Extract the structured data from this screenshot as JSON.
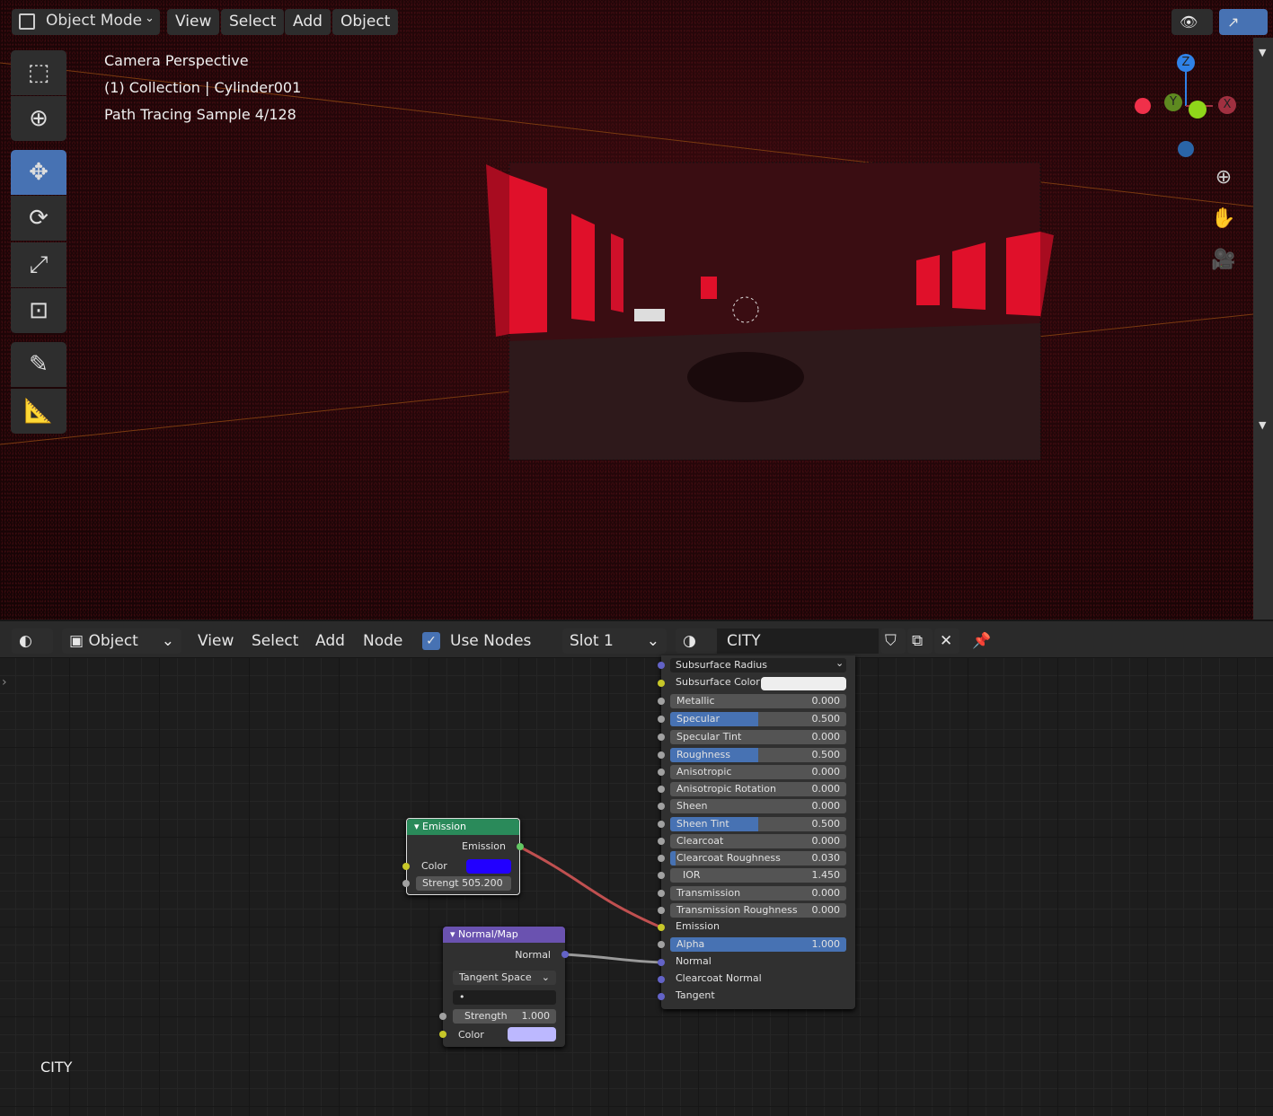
{
  "viewport": {
    "header": {
      "mode": "Object Mode",
      "menus": [
        "View",
        "Select",
        "Add",
        "Object"
      ]
    },
    "overlay": {
      "line1": "Camera Perspective",
      "line2": "(1) Collection | Cylinder001",
      "line3": "Path Tracing Sample 4/128"
    },
    "tools": [
      "select-box",
      "cursor",
      "move",
      "rotate",
      "scale",
      "transform",
      "annotate",
      "measure"
    ],
    "gizmo": {
      "x": "X",
      "y": "Y",
      "z": "Z"
    },
    "nav": [
      "zoom-icon",
      "pan-hand-icon",
      "camera-icon"
    ]
  },
  "node_editor": {
    "header": {
      "editor_type": "Object",
      "menus": [
        "View",
        "Select",
        "Add",
        "Node"
      ],
      "use_nodes_label": "Use Nodes",
      "use_nodes": true,
      "slot": "Slot 1",
      "material": "CITY"
    },
    "material_label": "CITY",
    "emission_node": {
      "title": "Emission",
      "output": "Emission",
      "color_label": "Color",
      "color": "#2200ff",
      "strength_label": "Strengt",
      "strength": "505.200"
    },
    "normalmap_node": {
      "title": "Normal/Map",
      "output": "Normal",
      "space": "Tangent Space",
      "uv": "•",
      "strength_label": "Strength",
      "strength": "1.000",
      "color_label": "Color",
      "color": "#bcb8ff"
    },
    "principled_rows": [
      {
        "label": "Subsurface Radius",
        "type": "dropdown",
        "socket": "#6363c7"
      },
      {
        "label": "Subsurface Color",
        "type": "color",
        "color": "#eeeeee",
        "socket": "#c7c729"
      },
      {
        "label": "Metallic",
        "value": "0.000",
        "fill": 0,
        "socket": "#a1a1a1"
      },
      {
        "label": "Specular",
        "value": "0.500",
        "fill": 0.5,
        "socket": "#a1a1a1"
      },
      {
        "label": "Specular Tint",
        "value": "0.000",
        "fill": 0,
        "socket": "#a1a1a1"
      },
      {
        "label": "Roughness",
        "value": "0.500",
        "fill": 0.5,
        "socket": "#a1a1a1"
      },
      {
        "label": "Anisotropic",
        "value": "0.000",
        "fill": 0,
        "socket": "#a1a1a1"
      },
      {
        "label": "Anisotropic Rotation",
        "value": "0.000",
        "fill": 0,
        "socket": "#a1a1a1"
      },
      {
        "label": "Sheen",
        "value": "0.000",
        "fill": 0,
        "socket": "#a1a1a1"
      },
      {
        "label": "Sheen Tint",
        "value": "0.500",
        "fill": 0.5,
        "socket": "#a1a1a1"
      },
      {
        "label": "Clearcoat",
        "value": "0.000",
        "fill": 0,
        "socket": "#a1a1a1"
      },
      {
        "label": "Clearcoat Roughness",
        "value": "0.030",
        "fill": 0.03,
        "socket": "#a1a1a1"
      },
      {
        "label": "IOR",
        "value": "1.450",
        "fill": 0,
        "socket": "#a1a1a1"
      },
      {
        "label": "Transmission",
        "value": "0.000",
        "fill": 0,
        "socket": "#a1a1a1"
      },
      {
        "label": "Transmission Roughness",
        "value": "0.000",
        "fill": 0,
        "socket": "#a1a1a1"
      },
      {
        "label": "Emission",
        "type": "socket",
        "socket": "#c7c729"
      },
      {
        "label": "Alpha",
        "value": "1.000",
        "fill": 1,
        "socket": "#a1a1a1"
      },
      {
        "label": "Normal",
        "type": "socket",
        "socket": "#6363c7"
      },
      {
        "label": "Clearcoat Normal",
        "type": "socket",
        "socket": "#6363c7"
      },
      {
        "label": "Tangent",
        "type": "socket",
        "socket": "#6363c7"
      }
    ]
  },
  "colors": {
    "accent": "#4772b3",
    "emission_header": "#2a8a5a",
    "normalmap_header": "#6a52b0",
    "link_emission": "#c05050"
  }
}
